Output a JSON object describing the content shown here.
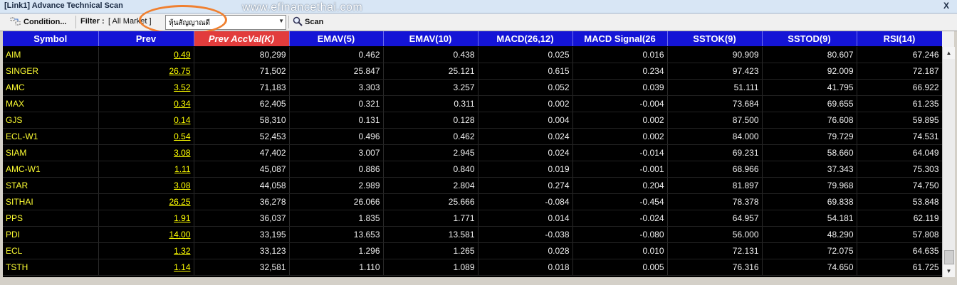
{
  "window": {
    "title": "[Link1] Advance Technical Scan",
    "watermark": "www.efinancethai.com",
    "close_label": "X"
  },
  "toolbar": {
    "condition_label": "Condition...",
    "filter_label": "Filter :",
    "filter_value": "[ All Market ]",
    "select_value": "หุ้นสัญญาณดี",
    "scan_label": "Scan"
  },
  "table": {
    "headers": [
      "Symbol",
      "Prev",
      "Prev AccVal(K)",
      "EMAV(5)",
      "EMAV(10)",
      "MACD(26,12)",
      "MACD Signal(26",
      "SSTOK(9)",
      "SSTOD(9)",
      "RSI(14)"
    ],
    "sorted_column": 2,
    "rows": [
      [
        "AIM",
        "0.49",
        "80,299",
        "0.462",
        "0.438",
        "0.025",
        "0.016",
        "90.909",
        "80.607",
        "67.246"
      ],
      [
        "SINGER",
        "26.75",
        "71,502",
        "25.847",
        "25.121",
        "0.615",
        "0.234",
        "97.423",
        "92.009",
        "72.187"
      ],
      [
        "AMC",
        "3.52",
        "71,183",
        "3.303",
        "3.257",
        "0.052",
        "0.039",
        "51.111",
        "41.795",
        "66.922"
      ],
      [
        "MAX",
        "0.34",
        "62,405",
        "0.321",
        "0.311",
        "0.002",
        "-0.004",
        "73.684",
        "69.655",
        "61.235"
      ],
      [
        "GJS",
        "0.14",
        "58,310",
        "0.131",
        "0.128",
        "0.004",
        "0.002",
        "87.500",
        "76.608",
        "59.895"
      ],
      [
        "ECL-W1",
        "0.54",
        "52,453",
        "0.496",
        "0.462",
        "0.024",
        "0.002",
        "84.000",
        "79.729",
        "74.531"
      ],
      [
        "SIAM",
        "3.08",
        "47,402",
        "3.007",
        "2.945",
        "0.024",
        "-0.014",
        "69.231",
        "58.660",
        "64.049"
      ],
      [
        "AMC-W1",
        "1.11",
        "45,087",
        "0.886",
        "0.840",
        "0.019",
        "-0.001",
        "68.966",
        "37.343",
        "75.303"
      ],
      [
        "STAR",
        "3.08",
        "44,058",
        "2.989",
        "2.804",
        "0.274",
        "0.204",
        "81.897",
        "79.968",
        "74.750"
      ],
      [
        "SITHAI",
        "26.25",
        "36,278",
        "26.066",
        "25.666",
        "-0.084",
        "-0.454",
        "78.378",
        "69.838",
        "53.848"
      ],
      [
        "PPS",
        "1.91",
        "36,037",
        "1.835",
        "1.771",
        "0.014",
        "-0.024",
        "64.957",
        "54.181",
        "62.119"
      ],
      [
        "PDI",
        "14.00",
        "33,195",
        "13.653",
        "13.581",
        "-0.038",
        "-0.080",
        "56.000",
        "48.290",
        "57.808"
      ],
      [
        "ECL",
        "1.32",
        "33,123",
        "1.296",
        "1.265",
        "0.028",
        "0.010",
        "72.131",
        "72.075",
        "64.635"
      ],
      [
        "TSTH",
        "1.14",
        "32,581",
        "1.110",
        "1.089",
        "0.018",
        "0.005",
        "76.316",
        "74.650",
        "61.725"
      ]
    ]
  },
  "icons": {
    "condition": "condition-icon",
    "scan": "magnifier-icon"
  },
  "colors": {
    "header_bg": "#1414d6",
    "sorted_header_bg": "#e23c3c",
    "grid_bg": "#000000",
    "symbol_text": "#ffff33",
    "highlight": "#f08030"
  }
}
